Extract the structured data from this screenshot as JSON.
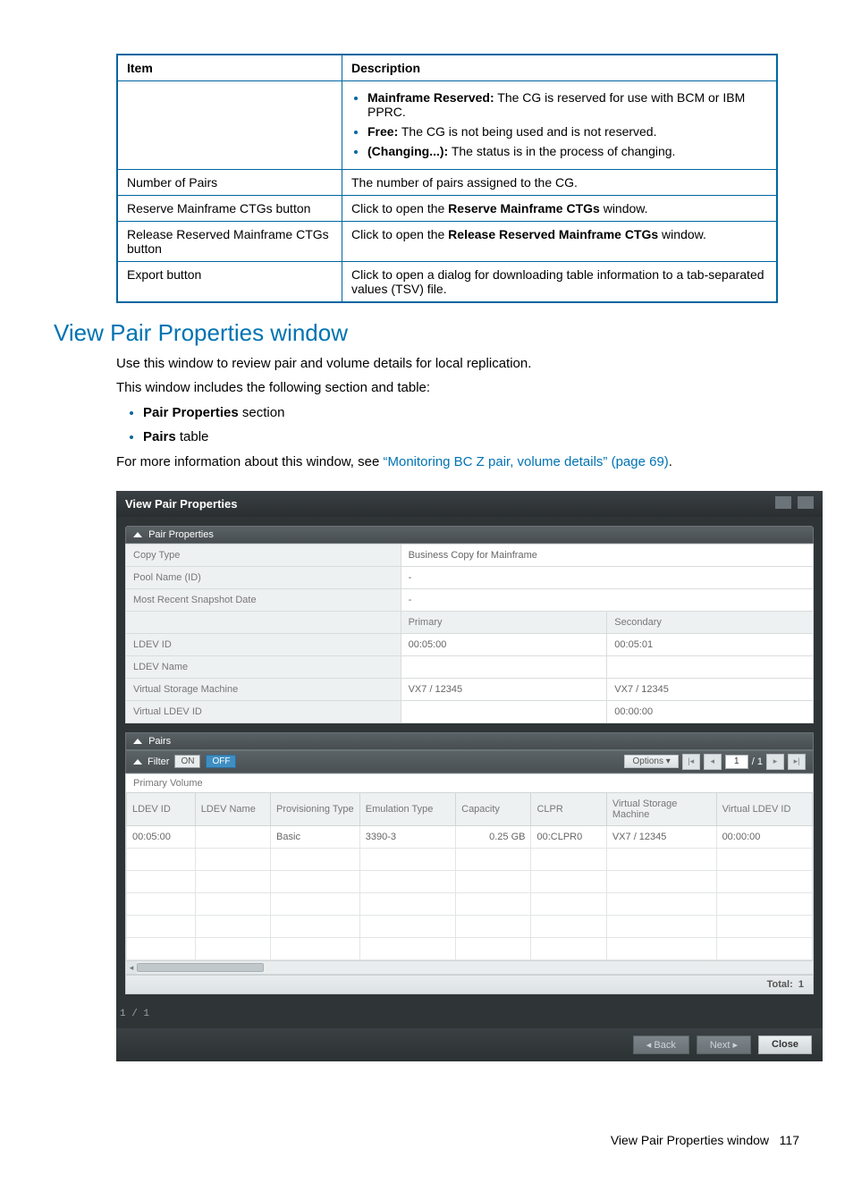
{
  "desc_table": {
    "headers": [
      "Item",
      "Description"
    ],
    "status_list": [
      {
        "label": "Mainframe Reserved:",
        "text": "The CG is reserved for use with BCM or IBM PPRC."
      },
      {
        "label": "Free:",
        "text": "The CG is not being used and is not reserved."
      },
      {
        "label": "(Changing...):",
        "text": "The status is in the process of changing."
      }
    ],
    "rows": [
      {
        "item": "Number of Pairs",
        "desc_plain": "The number of pairs assigned to the CG."
      },
      {
        "item": "Reserve Mainframe CTGs button",
        "desc_pre": "Click to open the ",
        "desc_bold": "Reserve Mainframe CTGs",
        "desc_post": " window."
      },
      {
        "item": "Release Reserved Mainframe CTGs button",
        "desc_pre": "Click to open the ",
        "desc_bold": "Release Reserved Mainframe CTGs",
        "desc_post": " window."
      },
      {
        "item": "Export button",
        "desc_plain": "Click to open a dialog for downloading table information to a tab-separated values (TSV) file."
      }
    ]
  },
  "section_title": "View Pair Properties window",
  "intro": {
    "p1": "Use this window to review pair and volume details for local replication.",
    "p2": "This window includes the following section and table:",
    "li1_bold": "Pair Properties",
    "li1_rest": " section",
    "li2_bold": "Pairs",
    "li2_rest": " table",
    "p3_pre": "For more information about this window, see ",
    "p3_link": "“Monitoring BC Z pair, volume details” (page 69)",
    "p3_post": "."
  },
  "panel": {
    "title": "View Pair Properties",
    "props_header": "Pair Properties",
    "props": {
      "copy_type_l": "Copy Type",
      "copy_type_v": "Business Copy for Mainframe",
      "pool_l": "Pool Name (ID)",
      "pool_v": "-",
      "snap_l": "Most Recent Snapshot Date",
      "snap_v": "-",
      "primary_h": "Primary",
      "secondary_h": "Secondary",
      "ldev_id_l": "LDEV ID",
      "ldev_id_p": "00:05:00",
      "ldev_id_s": "00:05:01",
      "ldev_name_l": "LDEV Name",
      "ldev_name_p": "",
      "ldev_name_s": "",
      "vsm_l": "Virtual Storage Machine",
      "vsm_p": "VX7 / 12345",
      "vsm_s": "VX7 / 12345",
      "vldev_l": "Virtual LDEV ID",
      "vldev_p": "",
      "vldev_s": "00:00:00"
    },
    "pairs_header": "Pairs",
    "filter": {
      "label": "Filter",
      "on": "ON",
      "off": "OFF",
      "options": "Options",
      "page": "1",
      "pages": "/ 1"
    },
    "grid_caption": "Primary Volume",
    "grid_headers": [
      "LDEV ID",
      "LDEV Name",
      "Provisioning Type",
      "Emulation Type",
      "Capacity",
      "CLPR",
      "Virtual Storage Machine",
      "Virtual LDEV ID"
    ],
    "grid_row": {
      "ldev_id": "00:05:00",
      "ldev_name": "",
      "prov": "Basic",
      "emul": "3390-3",
      "cap": "0.25 GB",
      "clpr": "00:CLPR0",
      "vsm": "VX7 / 12345",
      "vldev": "00:00:00"
    },
    "total_label": "Total:",
    "total_value": "1",
    "page_ind": "1 / 1",
    "btn_back": "Back",
    "btn_next": "Next",
    "btn_close": "Close"
  },
  "footer": {
    "text": "View Pair Properties window",
    "page": "117"
  }
}
